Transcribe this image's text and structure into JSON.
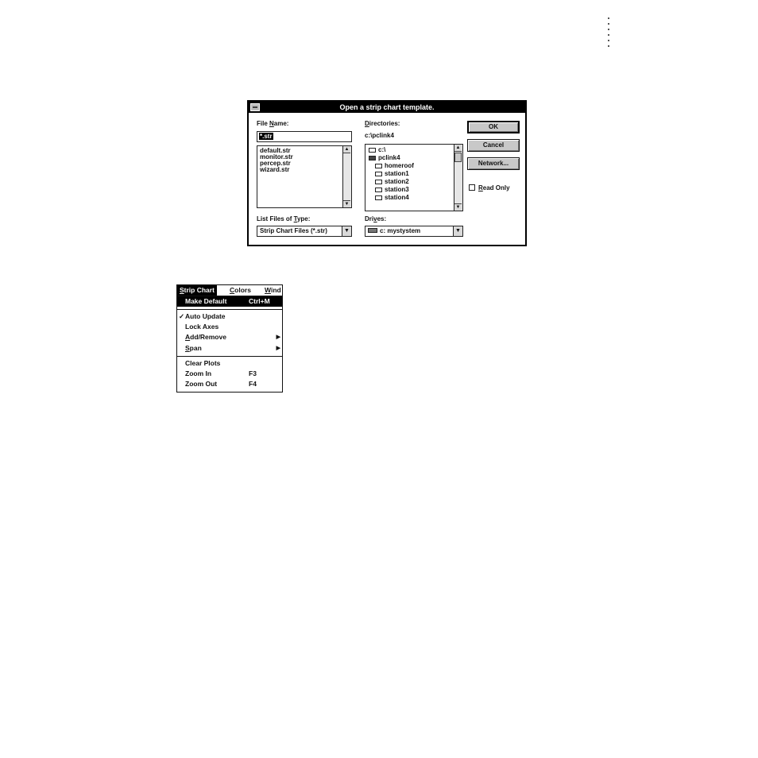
{
  "dialog": {
    "title": "Open a strip chart template.",
    "file_name_label_a": "File ",
    "file_name_label_u": "N",
    "file_name_label_b": "ame:",
    "file_name_value": "*.str",
    "files": [
      "default.str",
      "monitor.str",
      "percep.str",
      "wizard.str"
    ],
    "directories_label_u": "D",
    "directories_label_b": "irectories:",
    "current_path": "c:\\pclink4",
    "directories": [
      "c:\\",
      "pclink4",
      "homeroof",
      "station1",
      "station2",
      "station3",
      "station4"
    ],
    "list_type_label_a": "List Files of ",
    "list_type_label_u": "T",
    "list_type_label_b": "ype:",
    "list_type_value": "Strip Chart Files (*.str)",
    "drives_label_a": "Dri",
    "drives_label_u": "v",
    "drives_label_b": "es:",
    "drive_value": "c: mystystem",
    "ok_label": "OK",
    "cancel_label": "Cancel",
    "network_label": "Network...",
    "read_only_label_u": "R",
    "read_only_label_b": "ead Only",
    "read_only_checked": false
  },
  "menu": {
    "bar": {
      "strip_chart_u": "S",
      "strip_chart_b": "trip Chart",
      "colors_u": "C",
      "colors_b": "olors",
      "window_u": "W",
      "window_b": "ind"
    },
    "items": [
      {
        "label": "Make Default",
        "shortcut": "Ctrl+M"
      },
      {
        "label": "Auto Update",
        "checked": "✓"
      },
      {
        "label": "Lock Axes"
      },
      {
        "label_u": "A",
        "label_b": "dd/Remove"
      },
      {
        "label_u": "S",
        "label_b": "pan"
      },
      {
        "label": "Clear Plots"
      },
      {
        "label": "Zoom In",
        "shortcut": "F3"
      },
      {
        "label": "Zoom Out",
        "shortcut": "F4"
      }
    ]
  }
}
